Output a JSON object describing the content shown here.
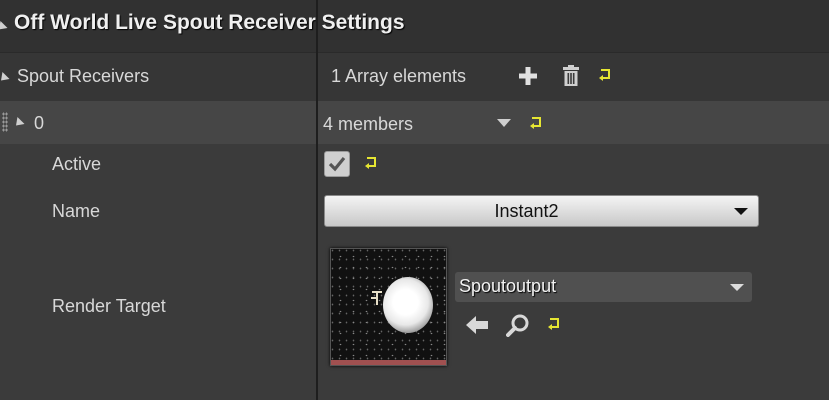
{
  "category": {
    "title": "Off World Live Spout Receiver Settings"
  },
  "receivers": {
    "label": "Spout Receivers",
    "count_text": "1 Array elements",
    "icons": [
      "add-icon",
      "delete-icon",
      "reset-to-default-icon"
    ]
  },
  "element": {
    "index": "0",
    "members_text": "4 members"
  },
  "properties": {
    "active": {
      "label": "Active",
      "checked": true
    },
    "name": {
      "label": "Name",
      "value": "Instant2"
    },
    "render_target": {
      "label": "Render Target",
      "asset": "Spoutoutput"
    }
  },
  "colors": {
    "reset_arrow": "#e6e632",
    "thumbnail_bar": "#a05050"
  }
}
